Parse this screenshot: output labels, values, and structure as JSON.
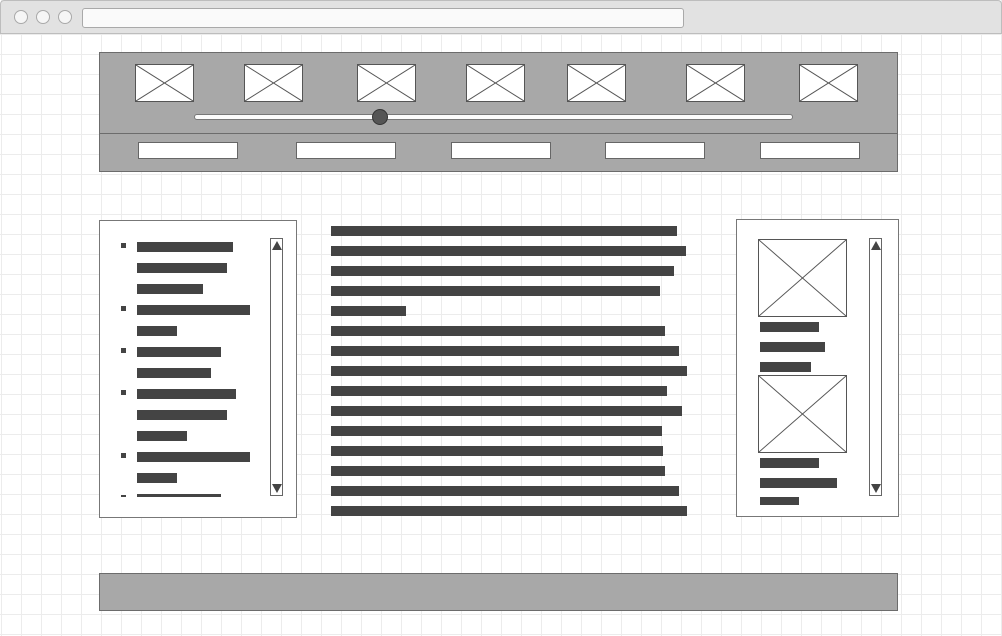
{
  "header": {
    "slider": {
      "value_fraction": 0.31
    },
    "nav_buttons": [
      {
        "label": ""
      },
      {
        "label": ""
      },
      {
        "label": ""
      },
      {
        "label": ""
      },
      {
        "label": ""
      }
    ]
  },
  "icons": {
    "image_placeholder": "image-placeholder-icon"
  },
  "colors": {
    "block": "#a8a8a8",
    "text_line": "#444444",
    "grid": "#ececec"
  }
}
